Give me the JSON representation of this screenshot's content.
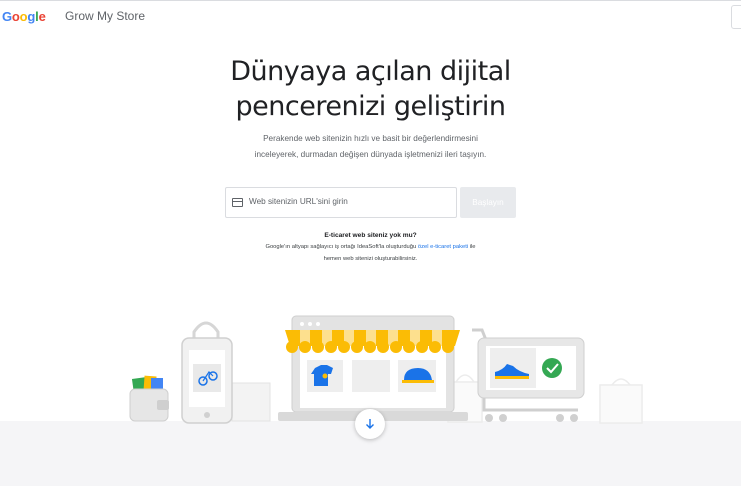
{
  "header": {
    "logo_letters": [
      {
        "char": "G",
        "color": "#4285F4"
      },
      {
        "char": "o",
        "color": "#EA4335"
      },
      {
        "char": "o",
        "color": "#FBBC05"
      },
      {
        "char": "g",
        "color": "#4285F4"
      },
      {
        "char": "l",
        "color": "#34A853"
      },
      {
        "char": "e",
        "color": "#EA4335"
      }
    ],
    "brand": "Grow My Store"
  },
  "hero": {
    "title_line1": "Dünyaya açılan dijital",
    "title_line2": "pencerenizi geliştirin",
    "subtitle_line1": "Perakende web sitenizin hızlı ve basit bir değerlendirmesini",
    "subtitle_line2": "inceleyerek, durmadan değişen dünyada işletmenizi ileri taşıyın."
  },
  "search": {
    "placeholder": "Web sitenizin URL'sini girin",
    "button_label": "Başlayın"
  },
  "ecommerce": {
    "title": "E-ticaret web siteniz yok mu?",
    "line1_prefix": "Google'ın altyapı sağlayıcı iş ortağı IdeaSoft'la oluşturduğu ",
    "line1_link": "özel e-ticaret paketi",
    "line1_suffix": " ile",
    "line2": "hemen web sitenizi oluşturabilirsiniz."
  },
  "illustration": {
    "awning_color": "#FBBC05",
    "check_color": "#34A853",
    "shirt_color": "#1a73e8",
    "shoe_color": "#1a73e8"
  },
  "scroll": {
    "icon": "arrow-down-icon"
  }
}
